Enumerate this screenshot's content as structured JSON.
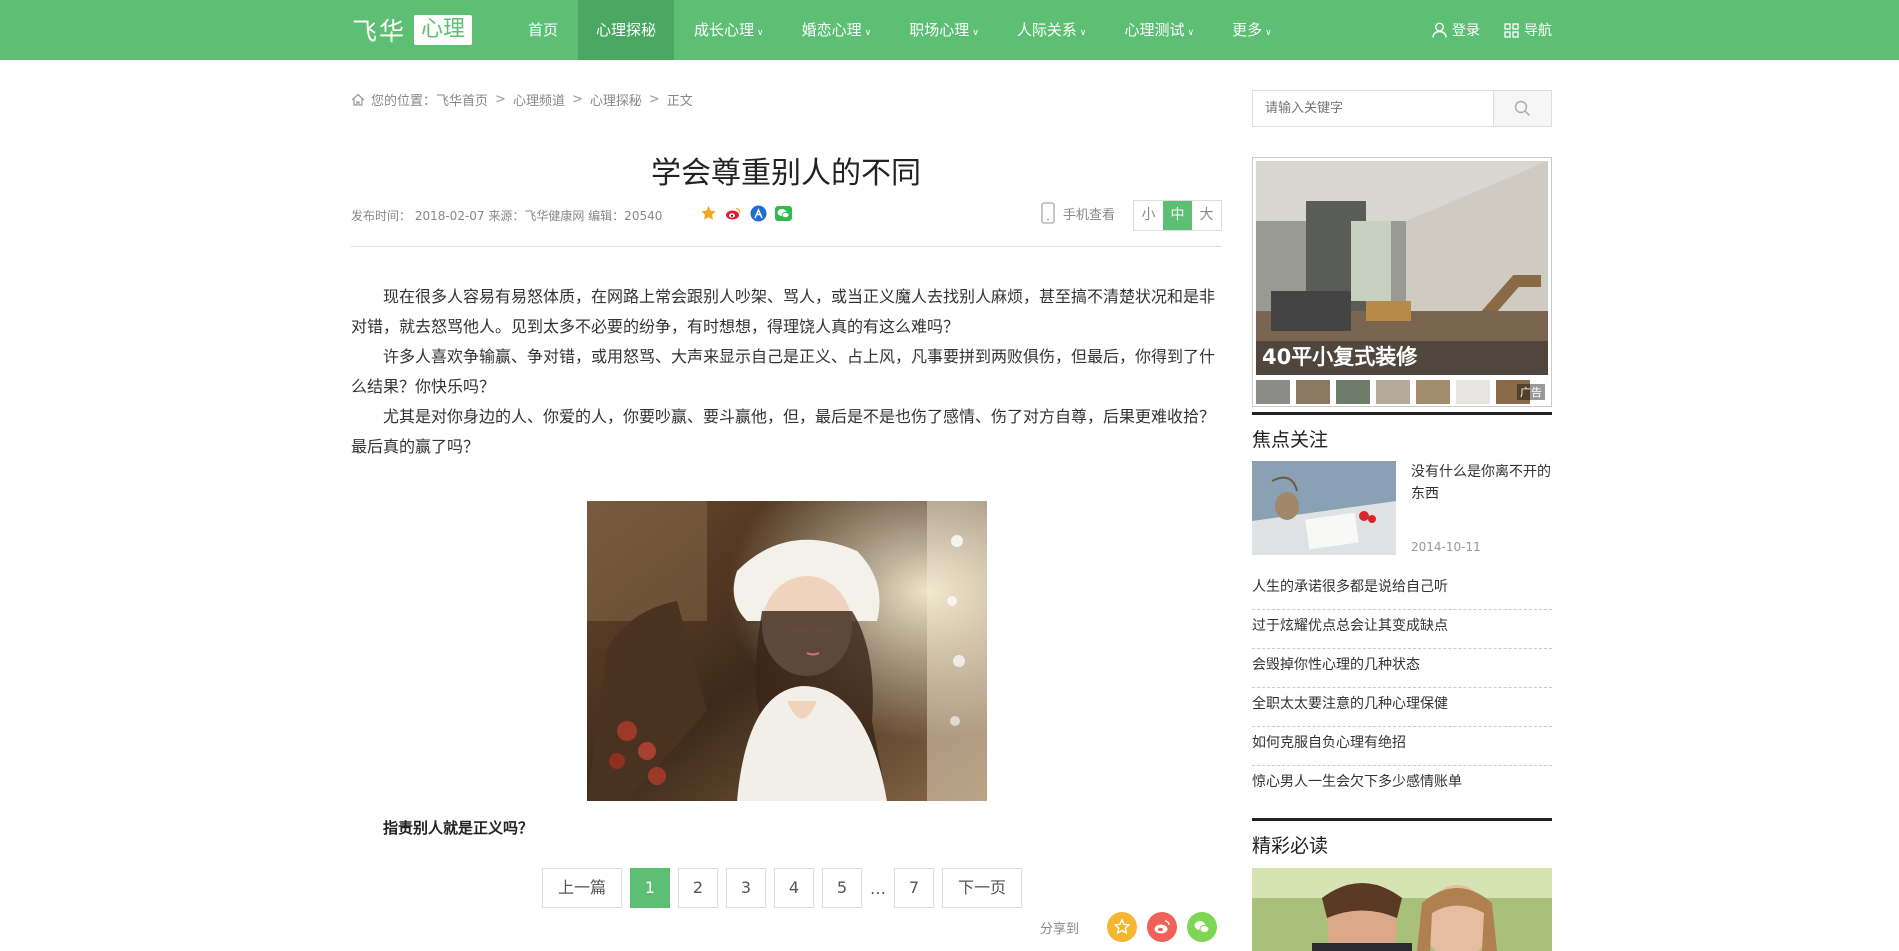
{
  "header": {
    "logo_text": "飞华",
    "logo_badge": "心理",
    "nav": [
      {
        "label": "首页",
        "dropdown": false,
        "active": false
      },
      {
        "label": "心理探秘",
        "dropdown": false,
        "active": true
      },
      {
        "label": "成长心理",
        "dropdown": true,
        "active": false
      },
      {
        "label": "婚恋心理",
        "dropdown": true,
        "active": false
      },
      {
        "label": "职场心理",
        "dropdown": true,
        "active": false
      },
      {
        "label": "人际关系",
        "dropdown": true,
        "active": false
      },
      {
        "label": "心理测试",
        "dropdown": true,
        "active": false
      },
      {
        "label": "更多",
        "dropdown": true,
        "active": false
      }
    ],
    "login_label": "登录",
    "guide_label": "导航",
    "accent_color": "#5cbf74"
  },
  "breadcrumb": {
    "prefix": "您的位置：",
    "items": [
      "飞华首页",
      "心理频道",
      "心理探秘",
      "正文"
    ],
    "separator": ">"
  },
  "article": {
    "title": "学会尊重别人的不同",
    "meta": "发布时间： 2018-02-07 来源：飞华健康网 编辑：20540",
    "share_icons": [
      "favorite-icon",
      "weibo-icon",
      "renren-icon",
      "wechat-icon"
    ],
    "mobile_label": "手机查看",
    "font_sizes": [
      "小",
      "中",
      "大"
    ],
    "font_size_selected": "中",
    "paragraphs": [
      "现在很多人容易有易怒体质，在网路上常会跟别人吵架、骂人，或当正义魔人去找别人麻烦，甚至搞不清楚状况和是非对错，就去怒骂他人。见到太多不必要的纷争，有时想想，得理饶人真的有这么难吗？",
      "许多人喜欢争输赢、争对错，或用怒骂、大声来显示自己是正义、占上风，凡事要拼到两败俱伤，但最后，你得到了什么结果？你快乐吗？",
      "尤其是对你身边的人、你爱的人，你要吵赢、要斗赢他，但，最后是不是也伤了感情、伤了对方自尊，后果更难收拾？最后真的赢了吗？"
    ],
    "subhead": "指责别人就是正义吗？"
  },
  "pager": {
    "prev": "上一篇",
    "pages": [
      "1",
      "2",
      "3",
      "4",
      "5"
    ],
    "current": "1",
    "ellipsis": "…",
    "last": "7",
    "next": "下一页"
  },
  "share": {
    "label": "分享到",
    "icons": [
      "favorite-icon",
      "weibo-icon",
      "wechat-icon"
    ]
  },
  "sidebar": {
    "search_placeholder": "请输入关键字",
    "ad_caption": "40平小复式装修",
    "ad_tag": "广告",
    "focus_title": "焦点关注",
    "focus_headline": "没有什么是你离不开的东西",
    "focus_date": "2014-10-11",
    "focus_list": [
      "人生的承诺很多都是说给自己听",
      "过于炫耀优点总会让其变成缺点",
      "会毁掉你性心理的几种状态",
      "全职太太要注意的几种心理保健",
      "如何克服自负心理有绝招",
      "惊心男人一生会欠下多少感情账单"
    ],
    "must_read_title": "精彩必读"
  }
}
